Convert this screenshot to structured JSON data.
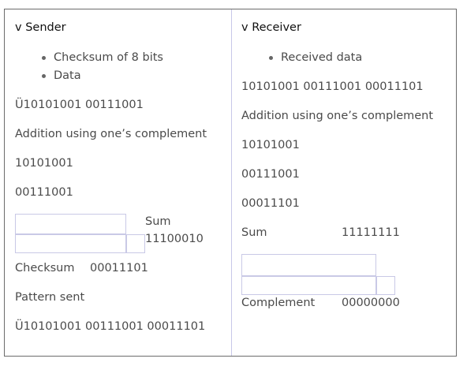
{
  "sender": {
    "heading": "v  Sender",
    "bullets": [
      "Checksum of 8 bits",
      "Data"
    ],
    "data_line": "Ü10101001 00111001",
    "addition": "Addition using one’s complement",
    "operand1": "10101001",
    "operand2": "00111001",
    "sum_label": "Sum",
    "sum_value": "11100010",
    "checksum_label": "Checksum",
    "checksum_value": "00011101",
    "pattern_label": "Pattern sent",
    "pattern_value": "Ü10101001 00111001 00011101"
  },
  "receiver": {
    "heading": "v  Receiver",
    "bullets": [
      "Received data"
    ],
    "data_line": "10101001 00111001 00011101",
    "addition": "Addition using one’s complement",
    "operand1": "10101001",
    "operand2": "00111001",
    "operand3": "00011101",
    "sum_label": "Sum",
    "sum_value": "11111111",
    "complement_label": "Complement",
    "complement_value": "00000000"
  }
}
